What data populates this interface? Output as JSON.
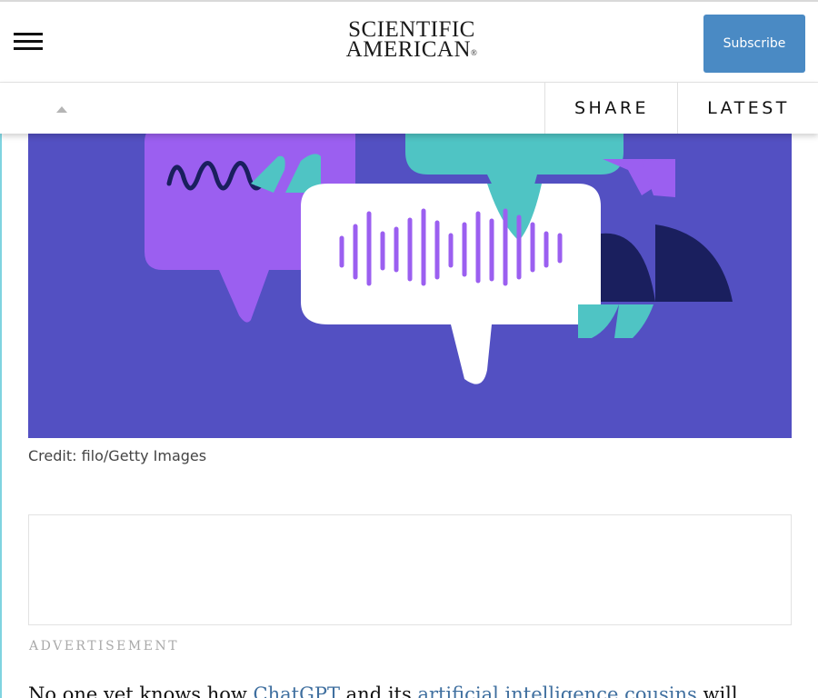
{
  "header": {
    "logo_line1": "SCIENTIFIC",
    "logo_line2": "AMERICAN",
    "logo_reg": "®",
    "menu_icon": "hamburger-menu-icon",
    "subscribe_label": "Subscribe"
  },
  "subbar": {
    "caret_icon": "chevron-up-icon",
    "share_label": "SHARE",
    "latest_label": "LATEST"
  },
  "hero": {
    "credit": "Credit: filo/Getty Images"
  },
  "ad": {
    "label": "ADVERTISEMENT"
  },
  "article": {
    "text_start": "No one yet knows how ",
    "link1": "ChatGPT",
    "text_mid": " and its ",
    "link2": "artificial intelligence cousins",
    "text_end": " will"
  },
  "colors": {
    "brand_blue": "#4a8ac4",
    "hero_background": "#5350c2",
    "purple": "#9b5ff0",
    "teal": "#4fc4c4",
    "navy": "#1a1f5e",
    "link": "#3f6f9f"
  }
}
